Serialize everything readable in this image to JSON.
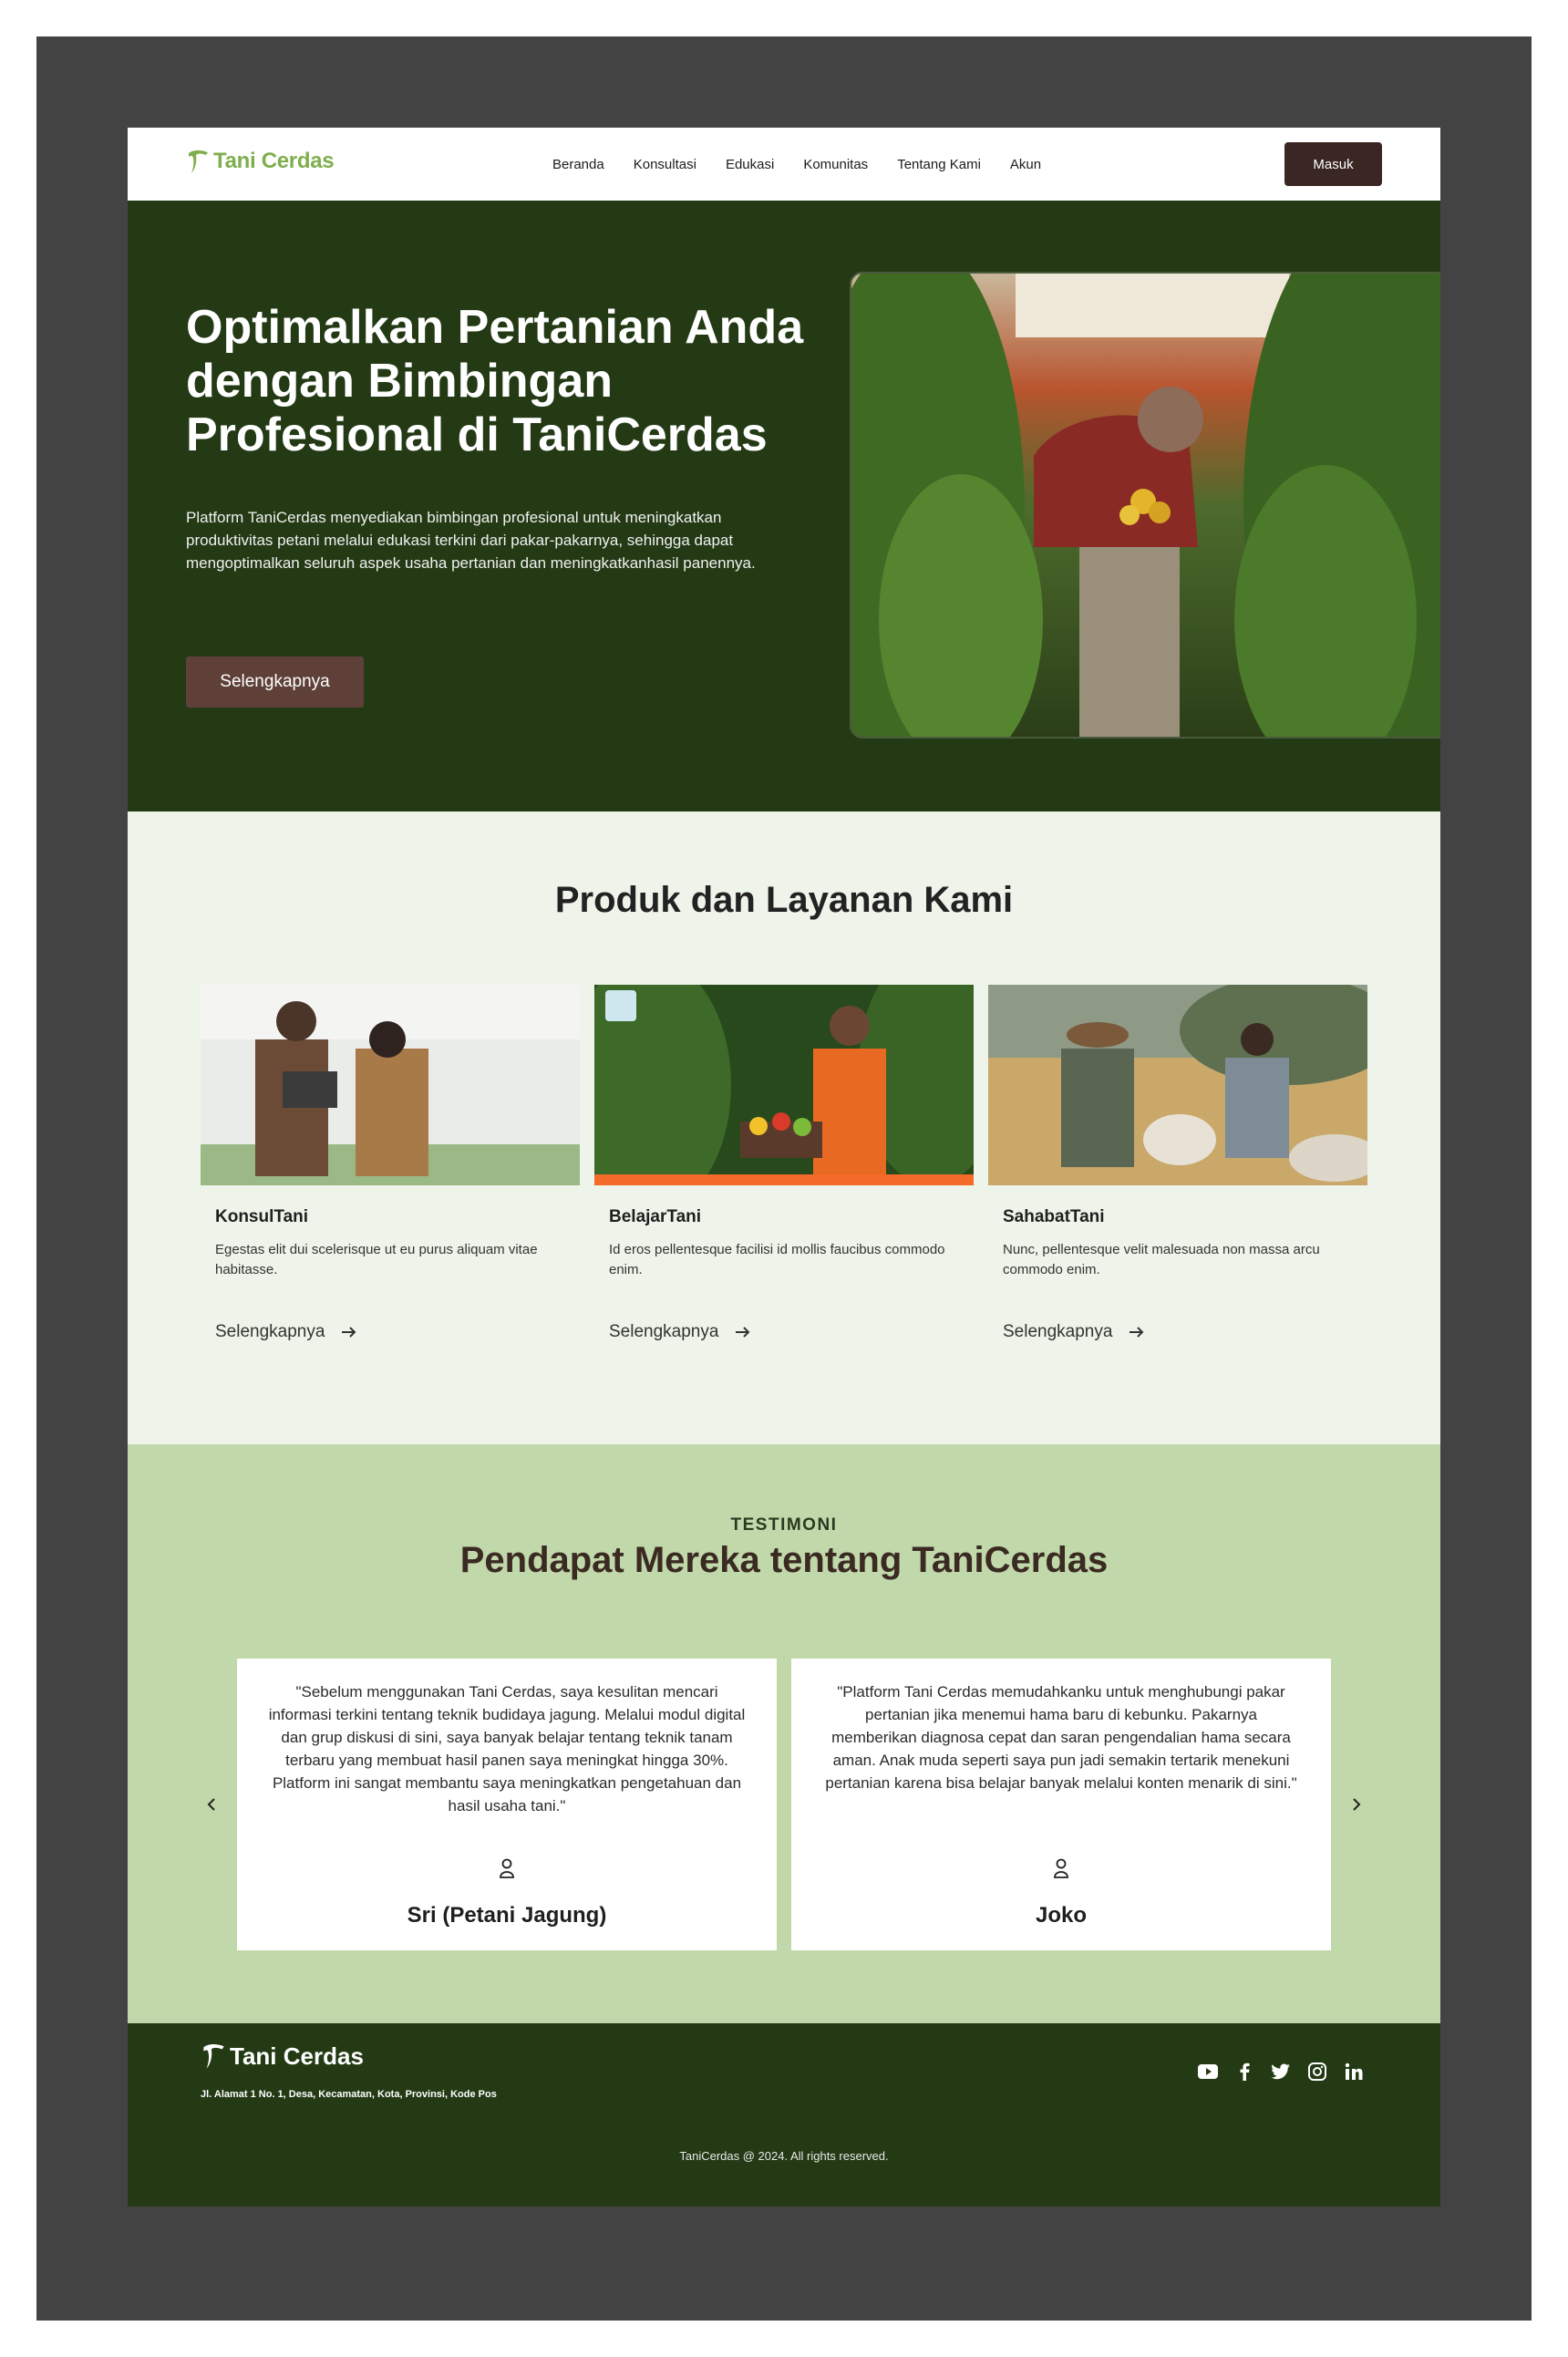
{
  "nav": {
    "logo_text": "Tani Cerdas",
    "menu": [
      "Beranda",
      "Konsultasi",
      "Edukasi",
      "Komunitas",
      "Tentang Kami",
      "Akun"
    ],
    "login_label": "Masuk"
  },
  "hero": {
    "title": "Optimalkan Pertanian Anda dengan Bimbingan Profesional di TaniCerdas",
    "description": "Platform TaniCerdas menyediakan bimbingan profesional untuk meningkatkan produktivitas petani melalui edukasi terkini dari pakar-pakarnya, sehingga dapat mengoptimalkan seluruh aspek usaha pertanian dan meningkatkanhasil panennya.",
    "cta_label": "Selengkapnya"
  },
  "products": {
    "title": "Produk dan Layanan Kami",
    "cards": [
      {
        "name": "KonsulTani",
        "desc": "Egestas elit dui scelerisque ut eu purus aliquam vitae habitasse.",
        "link": "Selengkapnya"
      },
      {
        "name": "BelajarTani",
        "desc": "Id eros pellentesque facilisi id mollis faucibus commodo enim.",
        "link": "Selengkapnya"
      },
      {
        "name": "SahabatTani",
        "desc": "Nunc, pellentesque velit malesuada non massa arcu commodo enim.",
        "link": "Selengkapnya"
      }
    ]
  },
  "testimonials": {
    "eyebrow": "TESTIMONI",
    "title": "Pendapat Mereka tentang TaniCerdas",
    "items": [
      {
        "quote": "\"Sebelum menggunakan Tani Cerdas, saya kesulitan mencari informasi terkini tentang teknik budidaya jagung. Melalui modul digital dan grup diskusi di sini, saya banyak belajar tentang teknik tanam terbaru yang membuat hasil panen saya meningkat hingga 30%. Platform ini sangat membantu saya meningkatkan pengetahuan dan hasil usaha tani.\"",
        "name": "Sri (Petani Jagung)"
      },
      {
        "quote": "\"Platform Tani Cerdas memudahkanku untuk menghubungi pakar pertanian jika menemui hama baru di kebunku. Pakarnya memberikan diagnosa cepat dan saran pengendalian hama secara aman. Anak muda seperti saya pun jadi semakin tertarik menekuni pertanian karena bisa belajar banyak melalui konten menarik di sini.\"",
        "name": "Joko"
      }
    ]
  },
  "footer": {
    "logo_text": "Tani Cerdas",
    "address": "Jl. Alamat 1 No. 1, Desa, Kecamatan, Kota, Provinsi, Kode Pos",
    "socials": [
      "youtube-icon",
      "facebook-icon",
      "twitter-icon",
      "instagram-icon",
      "linkedin-icon"
    ],
    "copyright": "TaniCerdas @ 2024. All rights reserved."
  },
  "colors": {
    "dark_green": "#233a15",
    "light_green": "#eef4e9",
    "sage": "#c1d8ab",
    "brown": "#5e4039",
    "dark_brown": "#3a2622",
    "logo_green": "#7fae4d"
  }
}
